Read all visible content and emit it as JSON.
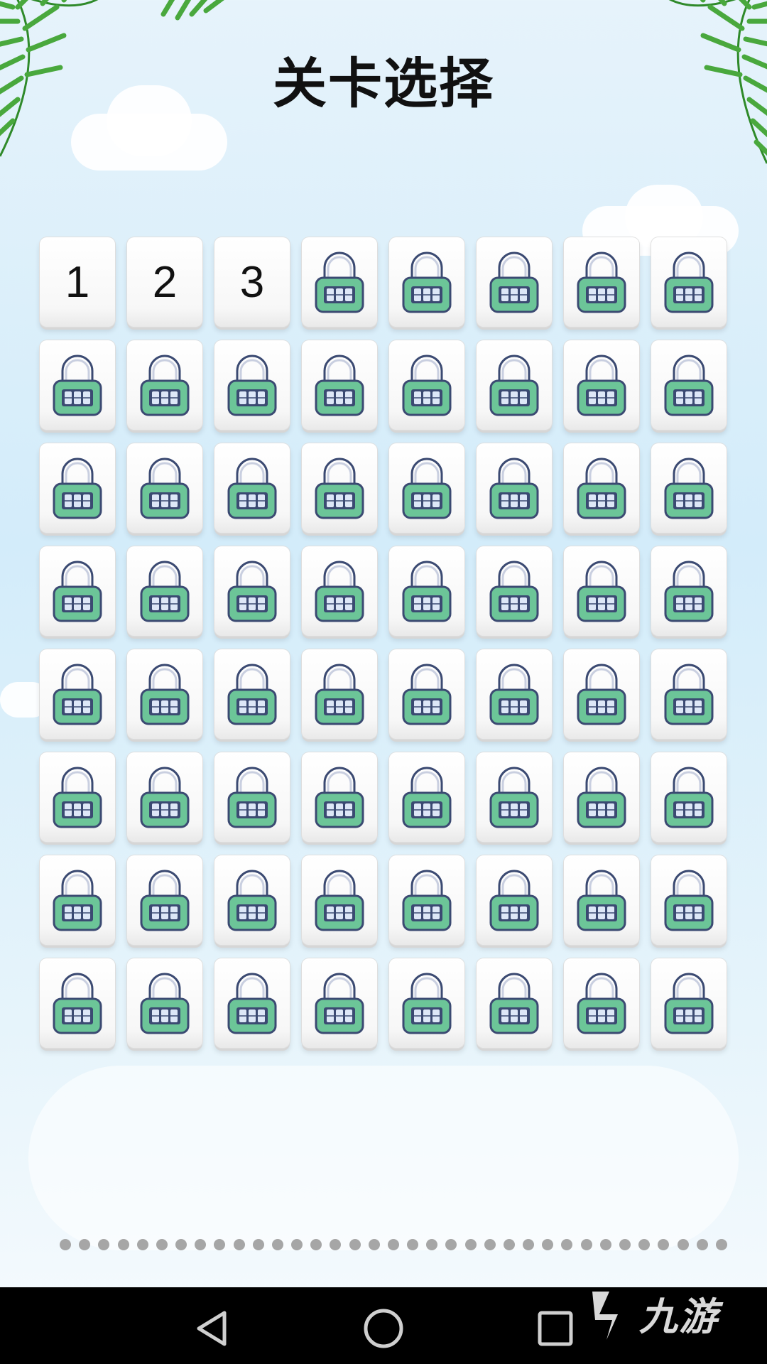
{
  "title": "关卡选择",
  "levels": [
    {
      "label": "1",
      "locked": false
    },
    {
      "label": "2",
      "locked": false
    },
    {
      "label": "3",
      "locked": false
    }
  ],
  "locked_count": 61,
  "total_levels": 64,
  "page_dots": 35,
  "watermark": "九游",
  "nav": [
    "back",
    "home",
    "recents"
  ],
  "colors": {
    "lock_body": "#6cc598",
    "lock_outline": "#3b4a72",
    "lock_digit": "#dde7f7",
    "dot": "#a6a6a6"
  }
}
